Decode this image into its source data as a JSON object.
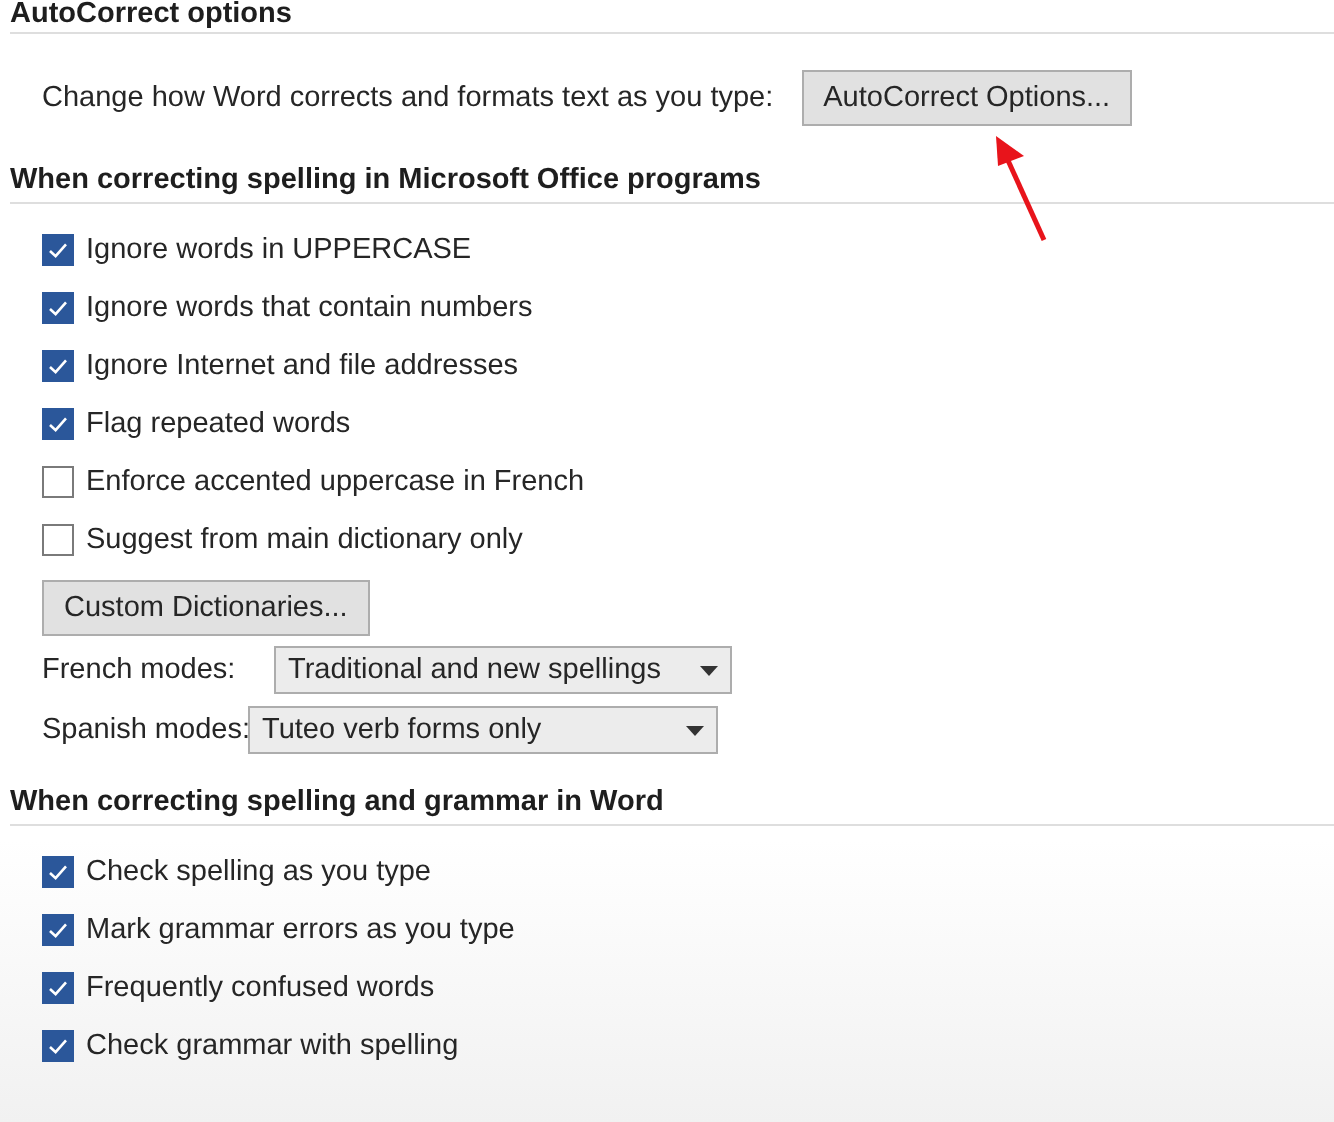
{
  "sections": [
    {
      "heading": "AutoCorrect options",
      "items": [
        {
          "kind": "text_button",
          "text": "Change how Word corrects and formats text as you type:",
          "button": "AutoCorrect Options..."
        }
      ]
    },
    {
      "heading": "When correcting spelling in Microsoft Office programs",
      "items": [
        {
          "kind": "checkbox",
          "label": "Ignore words in UPPERCASE",
          "checked": true
        },
        {
          "kind": "checkbox",
          "label": "Ignore words that contain numbers",
          "checked": true
        },
        {
          "kind": "checkbox",
          "label": "Ignore Internet and file addresses",
          "checked": true
        },
        {
          "kind": "checkbox",
          "label": "Flag repeated words",
          "checked": true
        },
        {
          "kind": "checkbox",
          "label": "Enforce accented uppercase in French",
          "checked": false
        },
        {
          "kind": "checkbox",
          "label": "Suggest from main dictionary only",
          "checked": false
        },
        {
          "kind": "button",
          "label": "Custom Dictionaries..."
        },
        {
          "kind": "dropdown",
          "label": "French modes:",
          "value": "Traditional and new spellings"
        },
        {
          "kind": "dropdown",
          "label": "Spanish modes:",
          "value": "Tuteo verb forms only"
        }
      ]
    },
    {
      "heading": "When correcting spelling and grammar in Word",
      "items": [
        {
          "kind": "checkbox",
          "label": "Check spelling as you type",
          "checked": true
        },
        {
          "kind": "checkbox",
          "label": "Mark grammar errors as you type",
          "checked": true
        },
        {
          "kind": "checkbox",
          "label": "Frequently confused words",
          "checked": true
        },
        {
          "kind": "checkbox",
          "label": "Check grammar with spelling",
          "checked": true
        }
      ]
    }
  ]
}
